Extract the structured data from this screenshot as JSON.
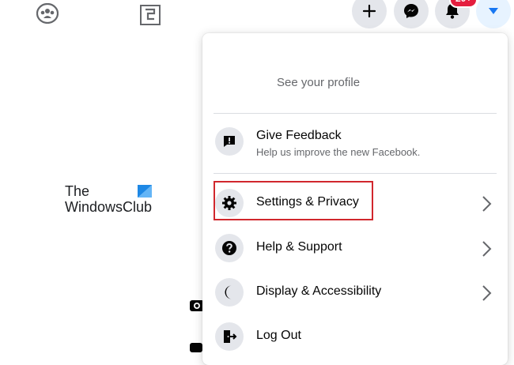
{
  "topnav": {
    "groups_icon": "groups-icon",
    "gaming_icon": "gaming-icon",
    "actions": {
      "create_icon": "plus-icon",
      "messenger_icon": "messenger-icon",
      "notifications_icon": "bell-icon",
      "notifications_badge": "20+",
      "account_icon": "caret-down-icon"
    }
  },
  "logo": {
    "line1": "The",
    "line2": "WindowsClub"
  },
  "menu": {
    "profile": {
      "label": "See your profile"
    },
    "feedback": {
      "label": "Give Feedback",
      "sub": "Help us improve the new Facebook.",
      "icon": "feedback-icon"
    },
    "items": [
      {
        "label": "Settings & Privacy",
        "icon": "gear-icon",
        "has_chevron": true,
        "highlighted": true
      },
      {
        "label": "Help & Support",
        "icon": "question-icon",
        "has_chevron": true
      },
      {
        "label": "Display & Accessibility",
        "icon": "moon-icon",
        "has_chevron": true
      },
      {
        "label": "Log Out",
        "icon": "logout-icon",
        "has_chevron": false
      }
    ]
  },
  "colors": {
    "highlight_border": "#d1272d",
    "account_button_bg": "#e7f3ff",
    "accent_blue": "#1877f2",
    "badge_red": "#e41e3f"
  }
}
